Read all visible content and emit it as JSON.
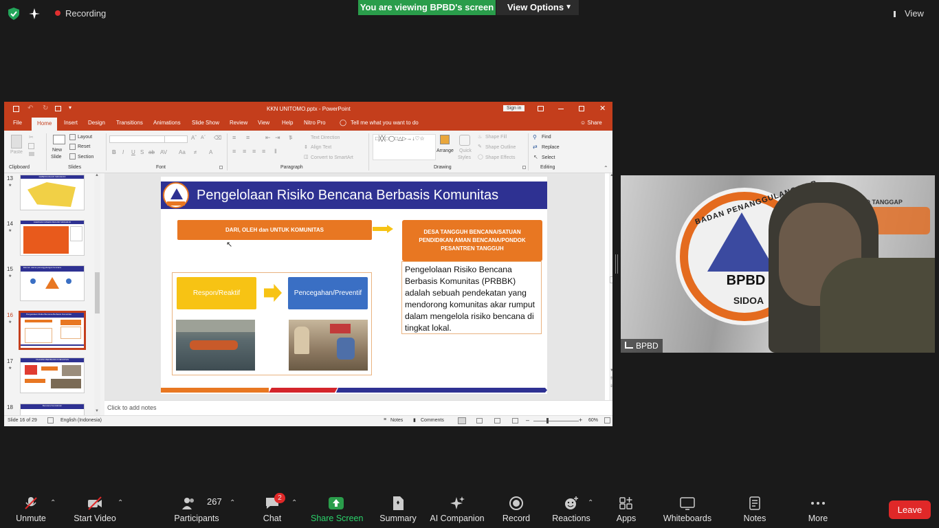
{
  "topbar": {
    "recording_label": "Recording",
    "viewing_banner": "You are viewing BPBD's screen",
    "view_options_label": "View Options",
    "view_label": "View"
  },
  "ppt": {
    "window_title": "KKN UNITOMO.pptx  -  PowerPoint",
    "sign_in": "Sign in",
    "tabs": [
      "File",
      "Home",
      "Insert",
      "Design",
      "Transitions",
      "Animations",
      "Slide Show",
      "Review",
      "View",
      "Help",
      "Nitro Pro"
    ],
    "tell_me": "Tell me what you want to do",
    "share": "Share",
    "ribbon": {
      "groups": {
        "clipboard": "Clipboard",
        "slides": "Slides",
        "font": "Font",
        "paragraph": "Paragraph",
        "drawing": "Drawing",
        "editing": "Editing"
      },
      "paste": "Paste",
      "new_slide": "New",
      "new_slide2": "Slide",
      "layout": "Layout",
      "reset": "Reset",
      "section": "Section",
      "text_direction": "Text Direction",
      "align_text": "Align Text",
      "convert_smartart": "Convert to SmartArt",
      "arrange": "Arrange",
      "quick_styles": "Quick",
      "quick_styles2": "Styles",
      "shape_fill": "Shape Fill",
      "shape_outline": "Shape Outline",
      "shape_effects": "Shape Effects",
      "find": "Find",
      "replace": "Replace",
      "select": "Select"
    },
    "thumbnails": [
      {
        "num": "13",
        "title": "KEBENCANAAN SIDOARJO"
      },
      {
        "num": "14",
        "title": "KAWASAN RAWAN BANJIR SIDOARJO"
      },
      {
        "num": "15",
        "title": "Elemen utama penanggulangan bencana"
      },
      {
        "num": "16",
        "title": "Pengelolaan Risiko Bencana Berbasis Komunitas"
      },
      {
        "num": "17",
        "title": "TAHAPAN BERBASIS KOMUNITAS"
      },
      {
        "num": "18",
        "title": "Bencana Kemiskinan"
      }
    ],
    "slide": {
      "title": "Pengelolaan Risiko Bencana Berbasis Komunitas",
      "box1": "DARI, OLEH dan UNTUK KOMUNITAS",
      "box2": "DESA TANGGUH BENCANA/SATUAN PENDIDIKAN AMAN BENCANA/PONDOK PESANTREN TANGGUH",
      "respon": "Respon/Reaktif",
      "pencegahan": "Pencegahan/Preventif",
      "description": "Pengelolaan Risiko Bencana Berbasis Komunitas (PRBBK) adalah sebuah pendekatan yang mendorong komunitas akar rumput dalam mengelola risiko bencana di tingkat lokal."
    },
    "notes_placeholder": "Click to add notes",
    "status": {
      "slide_count": "Slide 16 of 29",
      "language": "English (Indonesia)",
      "notes": "Notes",
      "comments": "Comments",
      "zoom": "60%"
    }
  },
  "video": {
    "name": "BPBD",
    "banner_text": "BADAN PENANGGULANGAN B",
    "logo_text": "BPBD",
    "city_text": "SIDOA",
    "top_text": "O TANGGAP"
  },
  "bottombar": {
    "unmute": "Unmute",
    "start_video": "Start Video",
    "participants": "Participants",
    "participants_count": "267",
    "chat": "Chat",
    "chat_badge": "2",
    "share_screen": "Share Screen",
    "summary": "Summary",
    "ai_companion": "AI Companion",
    "record": "Record",
    "reactions": "Reactions",
    "apps": "Apps",
    "whiteboards": "Whiteboards",
    "notes": "Notes",
    "more": "More",
    "leave": "Leave"
  },
  "colors": {
    "ppt_accent": "#c43e1c",
    "slide_header": "#2e3192",
    "slide_orange": "#e87722",
    "share_green": "#2a9d4b",
    "leave_red": "#e02828"
  }
}
